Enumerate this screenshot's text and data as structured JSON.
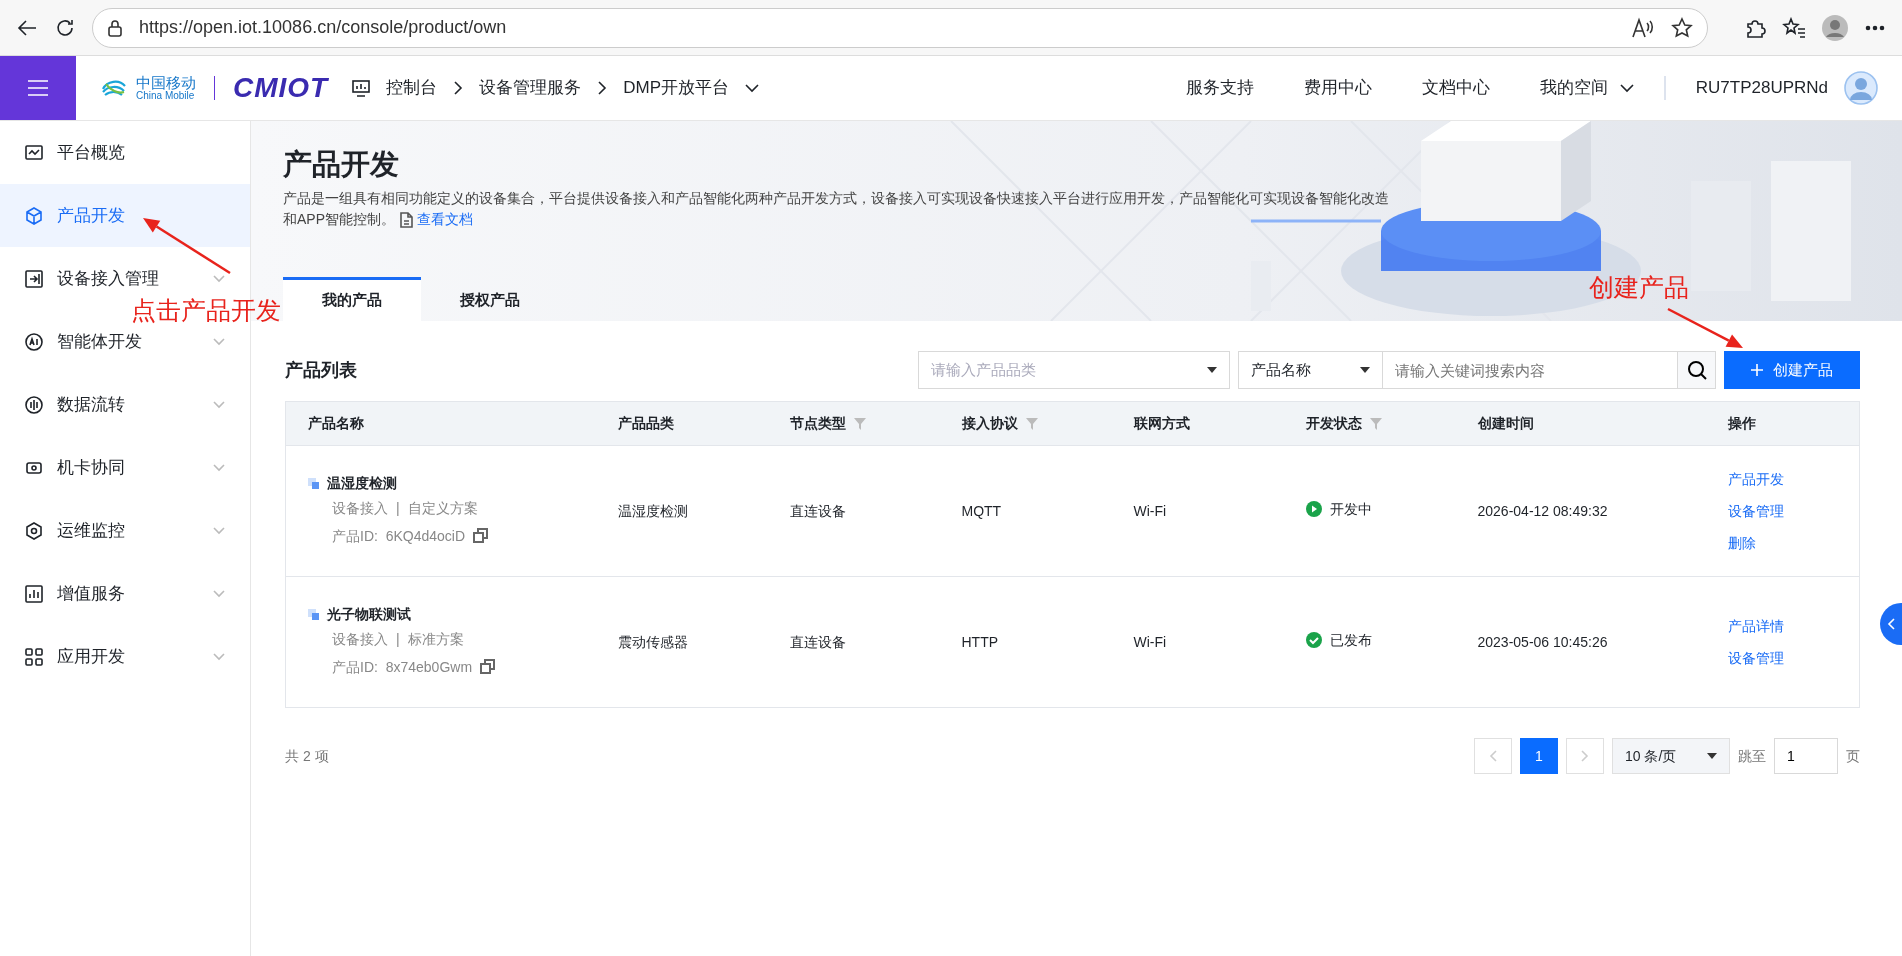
{
  "browser": {
    "url": "https://open.iot.10086.cn/console/product/own"
  },
  "header": {
    "logo_cn": "中国移动",
    "logo_en": "China Mobile",
    "brand": "CMIOT",
    "breadcrumb": [
      "控制台",
      "设备管理服务",
      "DMP开放平台"
    ],
    "nav": [
      "服务支持",
      "费用中心",
      "文档中心",
      "我的空间"
    ],
    "user": "RU7TP28UPRNd"
  },
  "sidebar": {
    "items": [
      {
        "label": "平台概览",
        "kind": "link",
        "selected": false
      },
      {
        "label": "产品开发",
        "kind": "link",
        "selected": true
      },
      {
        "label": "设备接入管理",
        "kind": "group",
        "selected": false
      },
      {
        "label": "智能体开发",
        "kind": "group",
        "selected": false
      },
      {
        "label": "数据流转",
        "kind": "group",
        "selected": false
      },
      {
        "label": "机卡协同",
        "kind": "group",
        "selected": false
      },
      {
        "label": "运维监控",
        "kind": "group",
        "selected": false
      },
      {
        "label": "增值服务",
        "kind": "group",
        "selected": false
      },
      {
        "label": "应用开发",
        "kind": "group",
        "selected": false
      }
    ]
  },
  "banner": {
    "title": "产品开发",
    "description": "产品是一组具有相同功能定义的设备集合，平台提供设备接入和产品智能化两种产品开发方式，设备接入可实现设备快速接入平台进行应用开发，产品智能化可实现设备智能化改造和APP智能控制。",
    "doc_link": "查看文档"
  },
  "tabs": [
    {
      "label": "我的产品",
      "selected": true
    },
    {
      "label": "授权产品",
      "selected": false
    }
  ],
  "list": {
    "title": "产品列表",
    "category_placeholder": "请输入产品品类",
    "field_select": "产品名称",
    "keyword_placeholder": "请输入关键词搜索内容",
    "create_button": "创建产品"
  },
  "table": {
    "columns": [
      {
        "label": "产品名称",
        "filter": false
      },
      {
        "label": "产品品类",
        "filter": false
      },
      {
        "label": "节点类型",
        "filter": true
      },
      {
        "label": "接入协议",
        "filter": true
      },
      {
        "label": "联网方式",
        "filter": false
      },
      {
        "label": "开发状态",
        "filter": true
      },
      {
        "label": "创建时间",
        "filter": false
      },
      {
        "label": "操作",
        "filter": false
      }
    ],
    "rows": [
      {
        "name": "温湿度检测",
        "access": "设备接入",
        "separator": "|",
        "scheme": "自定义方案",
        "id_label": "产品ID:",
        "id": "6KQ4d4ociD",
        "category": "温湿度检测",
        "node": "直连设备",
        "protocol": "MQTT",
        "network": "Wi-Fi",
        "status": {
          "text": "开发中",
          "kind": "developing"
        },
        "created": "2026-04-12 08:49:32",
        "actions": [
          "产品开发",
          "设备管理",
          "删除"
        ]
      },
      {
        "name": "光子物联测试",
        "access": "设备接入",
        "separator": "|",
        "scheme": "标准方案",
        "id_label": "产品ID:",
        "id": "8x74eb0Gwm",
        "category": "震动传感器",
        "node": "直连设备",
        "protocol": "HTTP",
        "network": "Wi-Fi",
        "status": {
          "text": "已发布",
          "kind": "published"
        },
        "created": "2023-05-06 10:45:26",
        "actions": [
          "产品详情",
          "设备管理"
        ]
      }
    ]
  },
  "pagination": {
    "total": "共 2 项",
    "pages": [
      {
        "label": "1",
        "selected": true
      }
    ],
    "page_size": "10 条/页",
    "jump_label": "跳至",
    "jump_value": "1",
    "jump_unit": "页"
  },
  "annotations": [
    {
      "text": "点击产品开发"
    },
    {
      "text": "创建产品"
    }
  ]
}
